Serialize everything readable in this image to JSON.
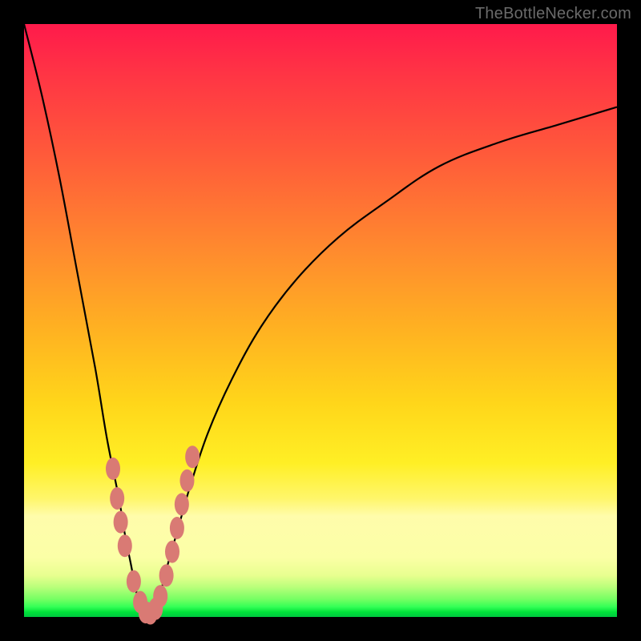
{
  "watermark": {
    "text": "TheBottleNecker.com"
  },
  "colors": {
    "frame": "#000000",
    "curve_stroke": "#000000",
    "marker_fill": "#d97a74",
    "gradient_top": "#ff1a4b",
    "gradient_mid": "#ffd61a",
    "gradient_bottom": "#00c840"
  },
  "chart_data": {
    "type": "line",
    "title": "",
    "xlabel": "",
    "ylabel": "",
    "xlim": [
      0,
      100
    ],
    "ylim": [
      0,
      100
    ],
    "grid": false,
    "legend": false,
    "series": [
      {
        "name": "bottleneck-curve",
        "x": [
          0,
          3,
          6,
          9,
          12,
          14,
          16,
          17,
          18,
          19,
          20,
          21,
          22,
          23,
          24,
          26,
          28,
          31,
          35,
          40,
          46,
          53,
          61,
          70,
          80,
          90,
          100
        ],
        "y": [
          100,
          88,
          74,
          58,
          42,
          30,
          20,
          14,
          9,
          4,
          1,
          0,
          1,
          4,
          8,
          15,
          22,
          31,
          40,
          49,
          57,
          64,
          70,
          76,
          80,
          83,
          86
        ]
      }
    ],
    "markers": {
      "name": "highlight-dots",
      "points": [
        {
          "x": 15.0,
          "y": 25
        },
        {
          "x": 15.7,
          "y": 20
        },
        {
          "x": 16.3,
          "y": 16
        },
        {
          "x": 17.0,
          "y": 12
        },
        {
          "x": 18.5,
          "y": 6
        },
        {
          "x": 19.6,
          "y": 2.5
        },
        {
          "x": 20.5,
          "y": 0.8
        },
        {
          "x": 21.3,
          "y": 0.6
        },
        {
          "x": 22.2,
          "y": 1.4
        },
        {
          "x": 23.0,
          "y": 3.5
        },
        {
          "x": 24.0,
          "y": 7
        },
        {
          "x": 25.0,
          "y": 11
        },
        {
          "x": 25.8,
          "y": 15
        },
        {
          "x": 26.6,
          "y": 19
        },
        {
          "x": 27.5,
          "y": 23
        },
        {
          "x": 28.4,
          "y": 27
        }
      ]
    }
  }
}
